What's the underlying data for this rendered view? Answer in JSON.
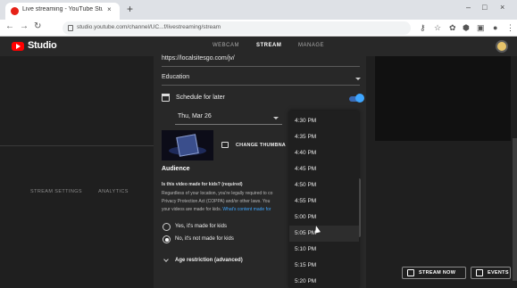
{
  "browser": {
    "tab_title": "Live streaming - YouTube Studio",
    "tab_close": "×",
    "new_tab": "+",
    "url": "studio.youtube.com/channel/UC...f/livestreaming/stream",
    "controls": {
      "minimize": "–",
      "maximize": "□",
      "close": "×"
    }
  },
  "header": {
    "brand": "Studio",
    "tabs": {
      "webcam": "WEBCAM",
      "stream": "STREAM",
      "manage": "MANAGE"
    }
  },
  "left": {
    "tabs": {
      "stream_settings": "STREAM SETTINGS",
      "analytics": "ANALYTICS"
    }
  },
  "dialog": {
    "url_value": "https://localsitesgo.com/jv/",
    "category": "Education",
    "schedule_label": "Schedule for later",
    "date": "Thu, Mar 26",
    "change_thumbnail": "CHANGE THUMBNA",
    "audience_title": "Audience",
    "kids_question": "Is this video made for kids? (required)",
    "kids_desc_1": "Regardless of your location, you're legally required to co",
    "kids_desc_2": "Privacy Protection Act (COPPA) and/or other laws. You",
    "kids_desc_3a": "your videos are made for kids. ",
    "kids_desc_3b": "What's content made for",
    "radio_yes": "Yes, it's made for kids",
    "radio_no": "No, it's not made for kids",
    "age_restriction": "Age restriction (advanced)"
  },
  "time_dropdown": {
    "items": [
      "4:30 PM",
      "4:35 PM",
      "4:40 PM",
      "4:45 PM",
      "4:50 PM",
      "4:55 PM",
      "5:00 PM",
      "5:05 PM",
      "5:10 PM",
      "5:15 PM",
      "5:20 PM"
    ],
    "highlighted_index": 7
  },
  "actions": {
    "stream_now": "STREAM NOW",
    "events": "EVENTS"
  },
  "colors": {
    "accent": "#3ea6ff",
    "brand": "#ff0000",
    "panel": "#282828",
    "background": "#1f1f1f"
  }
}
